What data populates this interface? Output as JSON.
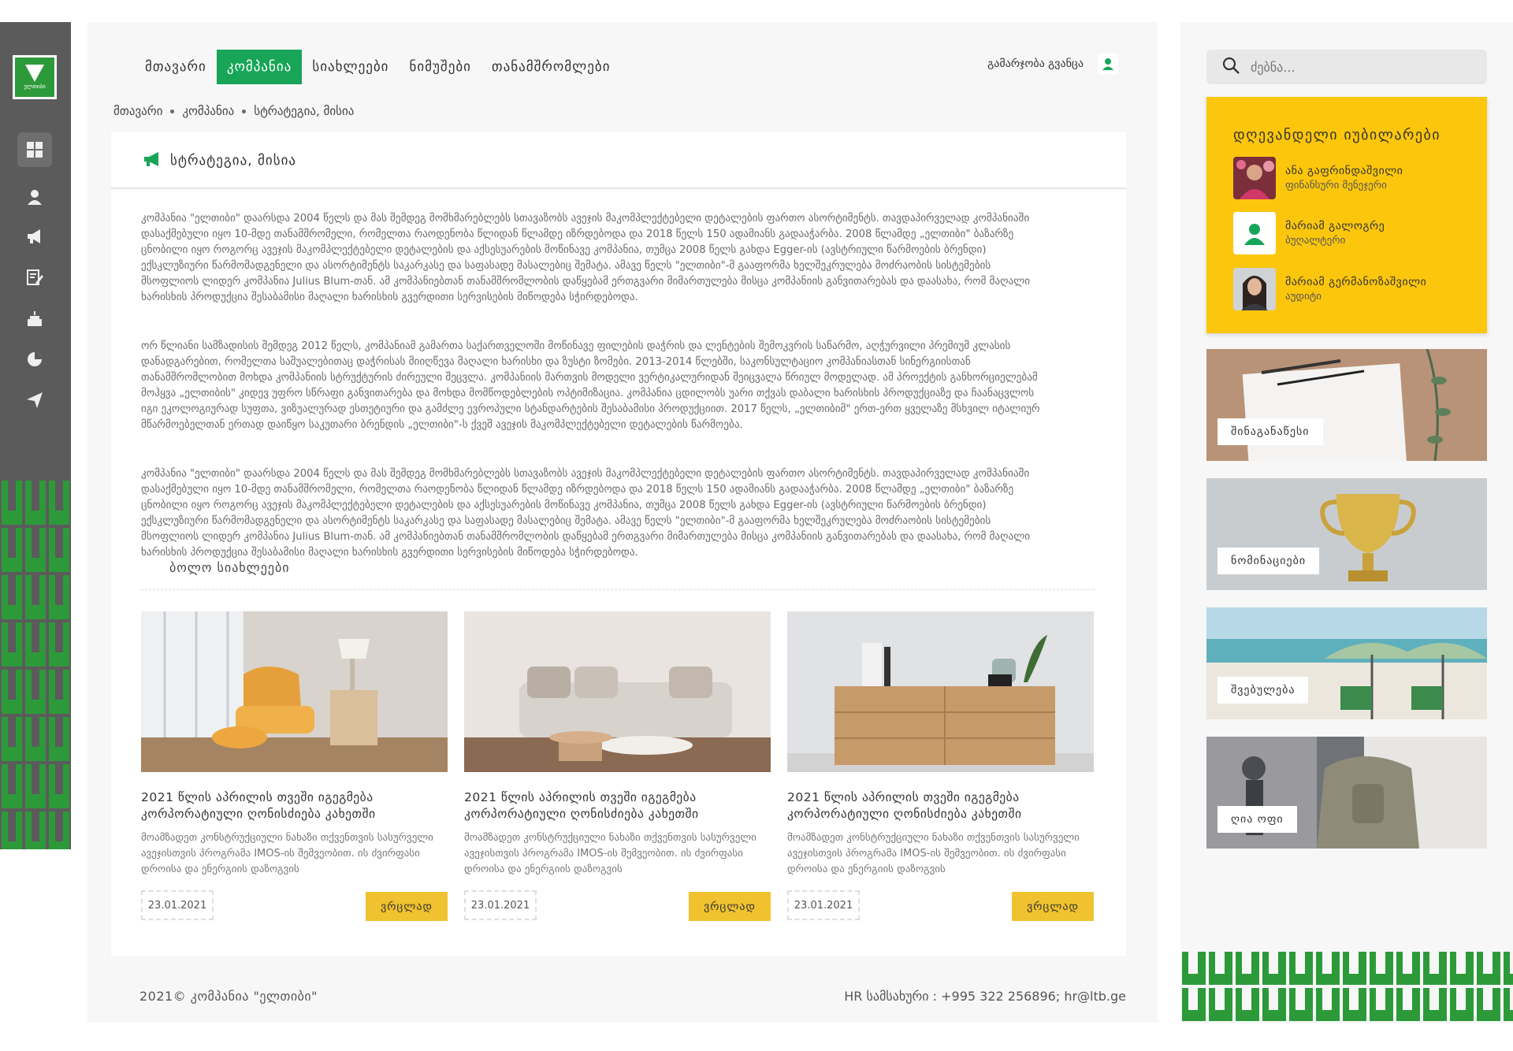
{
  "brand": {
    "logo_text": "ელთიბი",
    "accent": "#18a558",
    "yellow": "#fcc60c"
  },
  "nav": {
    "items": [
      {
        "label": "მთავარი",
        "active": false
      },
      {
        "label": "კომპანია",
        "active": true
      },
      {
        "label": "სიახლეები",
        "active": false
      },
      {
        "label": "ნიმუშები",
        "active": false
      },
      {
        "label": "თანამშრომლები",
        "active": false
      }
    ],
    "greeting": "გამარჯობა გვანცა"
  },
  "rail": {
    "icons": [
      "grid-icon",
      "user-icon",
      "megaphone-icon",
      "edit-icon",
      "cake-icon",
      "pie-chart-icon",
      "send-icon"
    ]
  },
  "breadcrumb": [
    "მთავარი",
    "კომპანია",
    "სტრატეგია, მისია"
  ],
  "page": {
    "title": "სტრატეგია, მისია",
    "paragraphs": [
      "კომპანია \"ელთიბი\" დაარსდა 2004 წელს და მას შემდეგ მომხმარებლებს სთავაზობს ავეჯის მაკომპლექტებელი დეტალების ფართო ასორტიმენტს. თავდაპირველად კომპანიაში დასაქმებული იყო 10-მდე თანამშრომელი, რომელთა რაოდენობა წლიდან წლამდე იზრდებოდა და 2018 წელს 150 ადამიანს გადააჭარბა. 2008 წლამდე „ელთიბი\" ბაზარზე ცნობილი იყო როგორც ავეჯის მაკომპლექტებელი დეტალების და აქსესუარების მოწინავე კომპანია, თუმცა 2008 წელს გახდა Egger-ის (ავსტრიული წარმოების ბრენდი) ექსკლუზიური წარმომადგენელი და ასორტიმენტს საკარკასე და საფასადე მასალებიც შემატა. ამავე წელს \"ელთიბი\"-მ გააფორმა ხელშეკრულება მოძრაობის სისტემების მსოფლიოს ლიდერ კომპანია Julius Blum-თან. ამ კომპანიებთან თანამშრომლობის დაწყებამ ერთგვარი მიმართულება მისცა კომპანიის განვითარებას და დაასახა, რომ მაღალი ხარისხის პროდუქცია შესაბამისი მაღალი ხარისხის გვერდითი სერვისების მიწოდება სჭირდებოდა.",
      "ორ წლიანი სამზადისის შემდეგ 2012 წელს, კომპანიამ გამართა საქართველოში მოწინავე ფილების დაჭრის და ლენტების შემოკვრის საწარმო, აღჭურვილი პრემიუმ კლასის დანადგარებით, რომელთა საშუალებითაც დაჭრისას მიიღწევა მაღალი ხარისხი და ზუსტი ზომები. 2013-2014 წლებში, საკონსულტაციო კომპანიასთან სინერგიისთან თანამშრომლობით მოხდა კომპანიის სტრუქტურის ძირეული შეცვლა. კომპანიის მართვის მოდელი ვერტიკალურიდან შეიცვალა წრიულ მოდელად. ამ პროექტის განხორციელებამ მოჰყვა „ელთიბის\" კიდევ უფრო სწრაფი განვითარება და მოხდა მომწოდებლების ოპტიმიზაცია. კომპანია ცდილობს უარი თქვას დაბალი ხარისხის პროდუქციაზე და ჩაანაცვლოს იგი ეკოლოგიურად სუფთა, ვიზუალურად ესთეტიური და გამძლე ევროპული სტანდარტების შესაბამისი პროდუქციით. 2017 წელს, „ელთიბიმ\" ერთ-ერთ ყველაზე მსხვილ იტალიურ მწარმოებელთან ერთად დაიწყო საკუთარი ბრენდის „ელთიბი\"-ს ქვეშ ავეჯის მაკომპლექტებელი დეტალების წარმოება.",
      "კომპანია \"ელთიბი\" დაარსდა 2004 წელს და მას შემდეგ მომხმარებლებს სთავაზობს ავეჯის მაკომპლექტებელი დეტალების ფართო ასორტიმენტს. თავდაპირველად კომპანიაში დასაქმებული იყო 10-მდე თანამშრომელი, რომელთა რაოდენობა წლიდან წლამდე იზრდებოდა და 2018 წელს 150 ადამიანს გადააჭარბა. 2008 წლამდე „ელთიბი\" ბაზარზე ცნობილი იყო როგორც ავეჯის მაკომპლექტებელი დეტალების და აქსესუარების მოწინავე კომპანია, თუმცა 2008 წელს გახდა Egger-ის (ავსტრიული წარმოების ბრენდი) ექსკლუზიური წარმომადგენელი და ასორტიმენტს საკარკასე და საფასადე მასალებიც შემატა. ამავე წელს \"ელთიბი\"-მ გააფორმა ხელშეკრულება მოძრაობის სისტემების მსოფლიოს ლიდერ კომპანია Julius Blum-თან. ამ კომპანიებთან თანამშრომლობის დაწყებამ ერთგვარი მიმართულება მისცა კომპანიის განვითარებას და დაასახა, რომ მაღალი ხარისხის პროდუქცია შესაბამისი მაღალი ხარისხის გვერდითი სერვისების მიწოდება სჭირდებოდა."
    ]
  },
  "news": {
    "heading": "ბოლო სიახლეები",
    "cards": [
      {
        "title": "2021 წლის აპრილის თვეში იგეგმება კორპორატიული ღონისძიება კახეთში",
        "desc": "მოამზადეთ კონსტრუქციული ნახაზი თქვენთვის სასურველი ავეჯისთვის პროგრამა IMOS-ის შემვეობით. ის ძვირფასი დროისა და ენერგიის დაზოგვის",
        "date": "23.01.2021",
        "more": "ვრცლად"
      },
      {
        "title": "2021 წლის აპრილის თვეში იგეგმება კორპორატიული ღონისძიება კახეთში",
        "desc": "მოამზადეთ კონსტრუქციული ნახაზი თქვენთვის სასურველი ავეჯისთვის პროგრამა IMOS-ის შემვეობით. ის ძვირფასი დროისა და ენერგიის დაზოგვის",
        "date": "23.01.2021",
        "more": "ვრცლად"
      },
      {
        "title": "2021 წლის აპრილის თვეში იგეგმება კორპორატიული ღონისძიება კახეთში",
        "desc": "მოამზადეთ კონსტრუქციული ნახაზი თქვენთვის სასურველი ავეჯისთვის პროგრამა IMOS-ის შემვეობით. ის ძვირფასი დროისა და ენერგიის დაზოგვის",
        "date": "23.01.2021",
        "more": "ვრცლად"
      }
    ]
  },
  "footer": {
    "copyright": "2021© კომპანია \"ელთიბი\"",
    "contact": "HR სამსახური : +995 322 256896; hr@ltb.ge"
  },
  "sidebar": {
    "search_placeholder": "ძებნა...",
    "jubilee_title": "დღევანდელი იუბილარები",
    "people": [
      {
        "name": "ანა გაფრინდაშვილი",
        "role": "ფინანსური მენეჯერი"
      },
      {
        "name": "მარიამ გალოგრე",
        "role": "ბუღალტერი"
      },
      {
        "name": "მარიამ გერმანოზაშვილი",
        "role": "აუდიტი"
      }
    ],
    "tiles": [
      "შინაგანაწესი",
      "ნომინაციები",
      "შვებულება",
      "ღია ოფი"
    ]
  }
}
